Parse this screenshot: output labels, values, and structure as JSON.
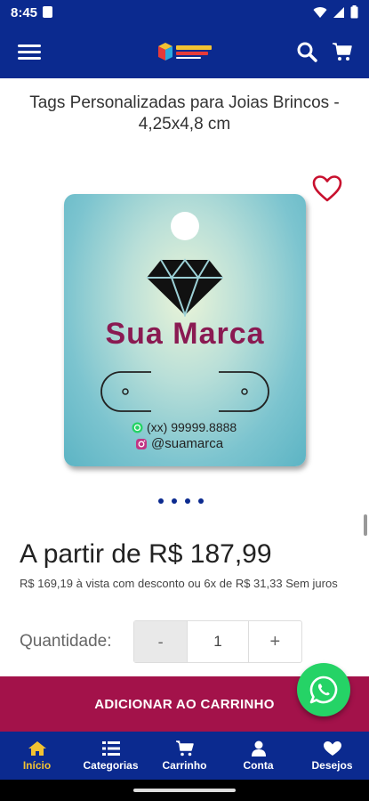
{
  "status_bar": {
    "time": "8:45"
  },
  "app_bar": {
    "logo_icon": "store-logo"
  },
  "product": {
    "title": "Tags Personalizadas para Joias Brincos - 4,25x4,8 cm",
    "image": {
      "brand_text": "Sua Marca",
      "phone_text": "(xx) 99999.8888",
      "instagram_text": "@suamarca"
    },
    "carousel": {
      "count": 4,
      "active_index": 0
    },
    "price_text": "A partir de R$ 187,99",
    "installments_text": "R$ 169,19 à vista com desconto ou 6x de R$ 31,33 Sem juros",
    "quantity": {
      "label": "Quantidade:",
      "minus": "-",
      "value": "1",
      "plus": "+"
    }
  },
  "add_to_cart_label": "ADICIONAR AO CARRINHO",
  "bottom_nav": {
    "items": [
      {
        "label": "Início",
        "icon": "home-icon",
        "active": true
      },
      {
        "label": "Categorias",
        "icon": "list-icon",
        "active": false
      },
      {
        "label": "Carrinho",
        "icon": "cart-icon",
        "active": false
      },
      {
        "label": "Conta",
        "icon": "user-icon",
        "active": false
      },
      {
        "label": "Desejos",
        "icon": "heart-icon",
        "active": false
      }
    ]
  },
  "colors": {
    "primary": "#0b2a8f",
    "accent": "#a3124a",
    "active_nav": "#f2c232",
    "whatsapp": "#25d366",
    "wishlist_heart": "#c8102e"
  }
}
